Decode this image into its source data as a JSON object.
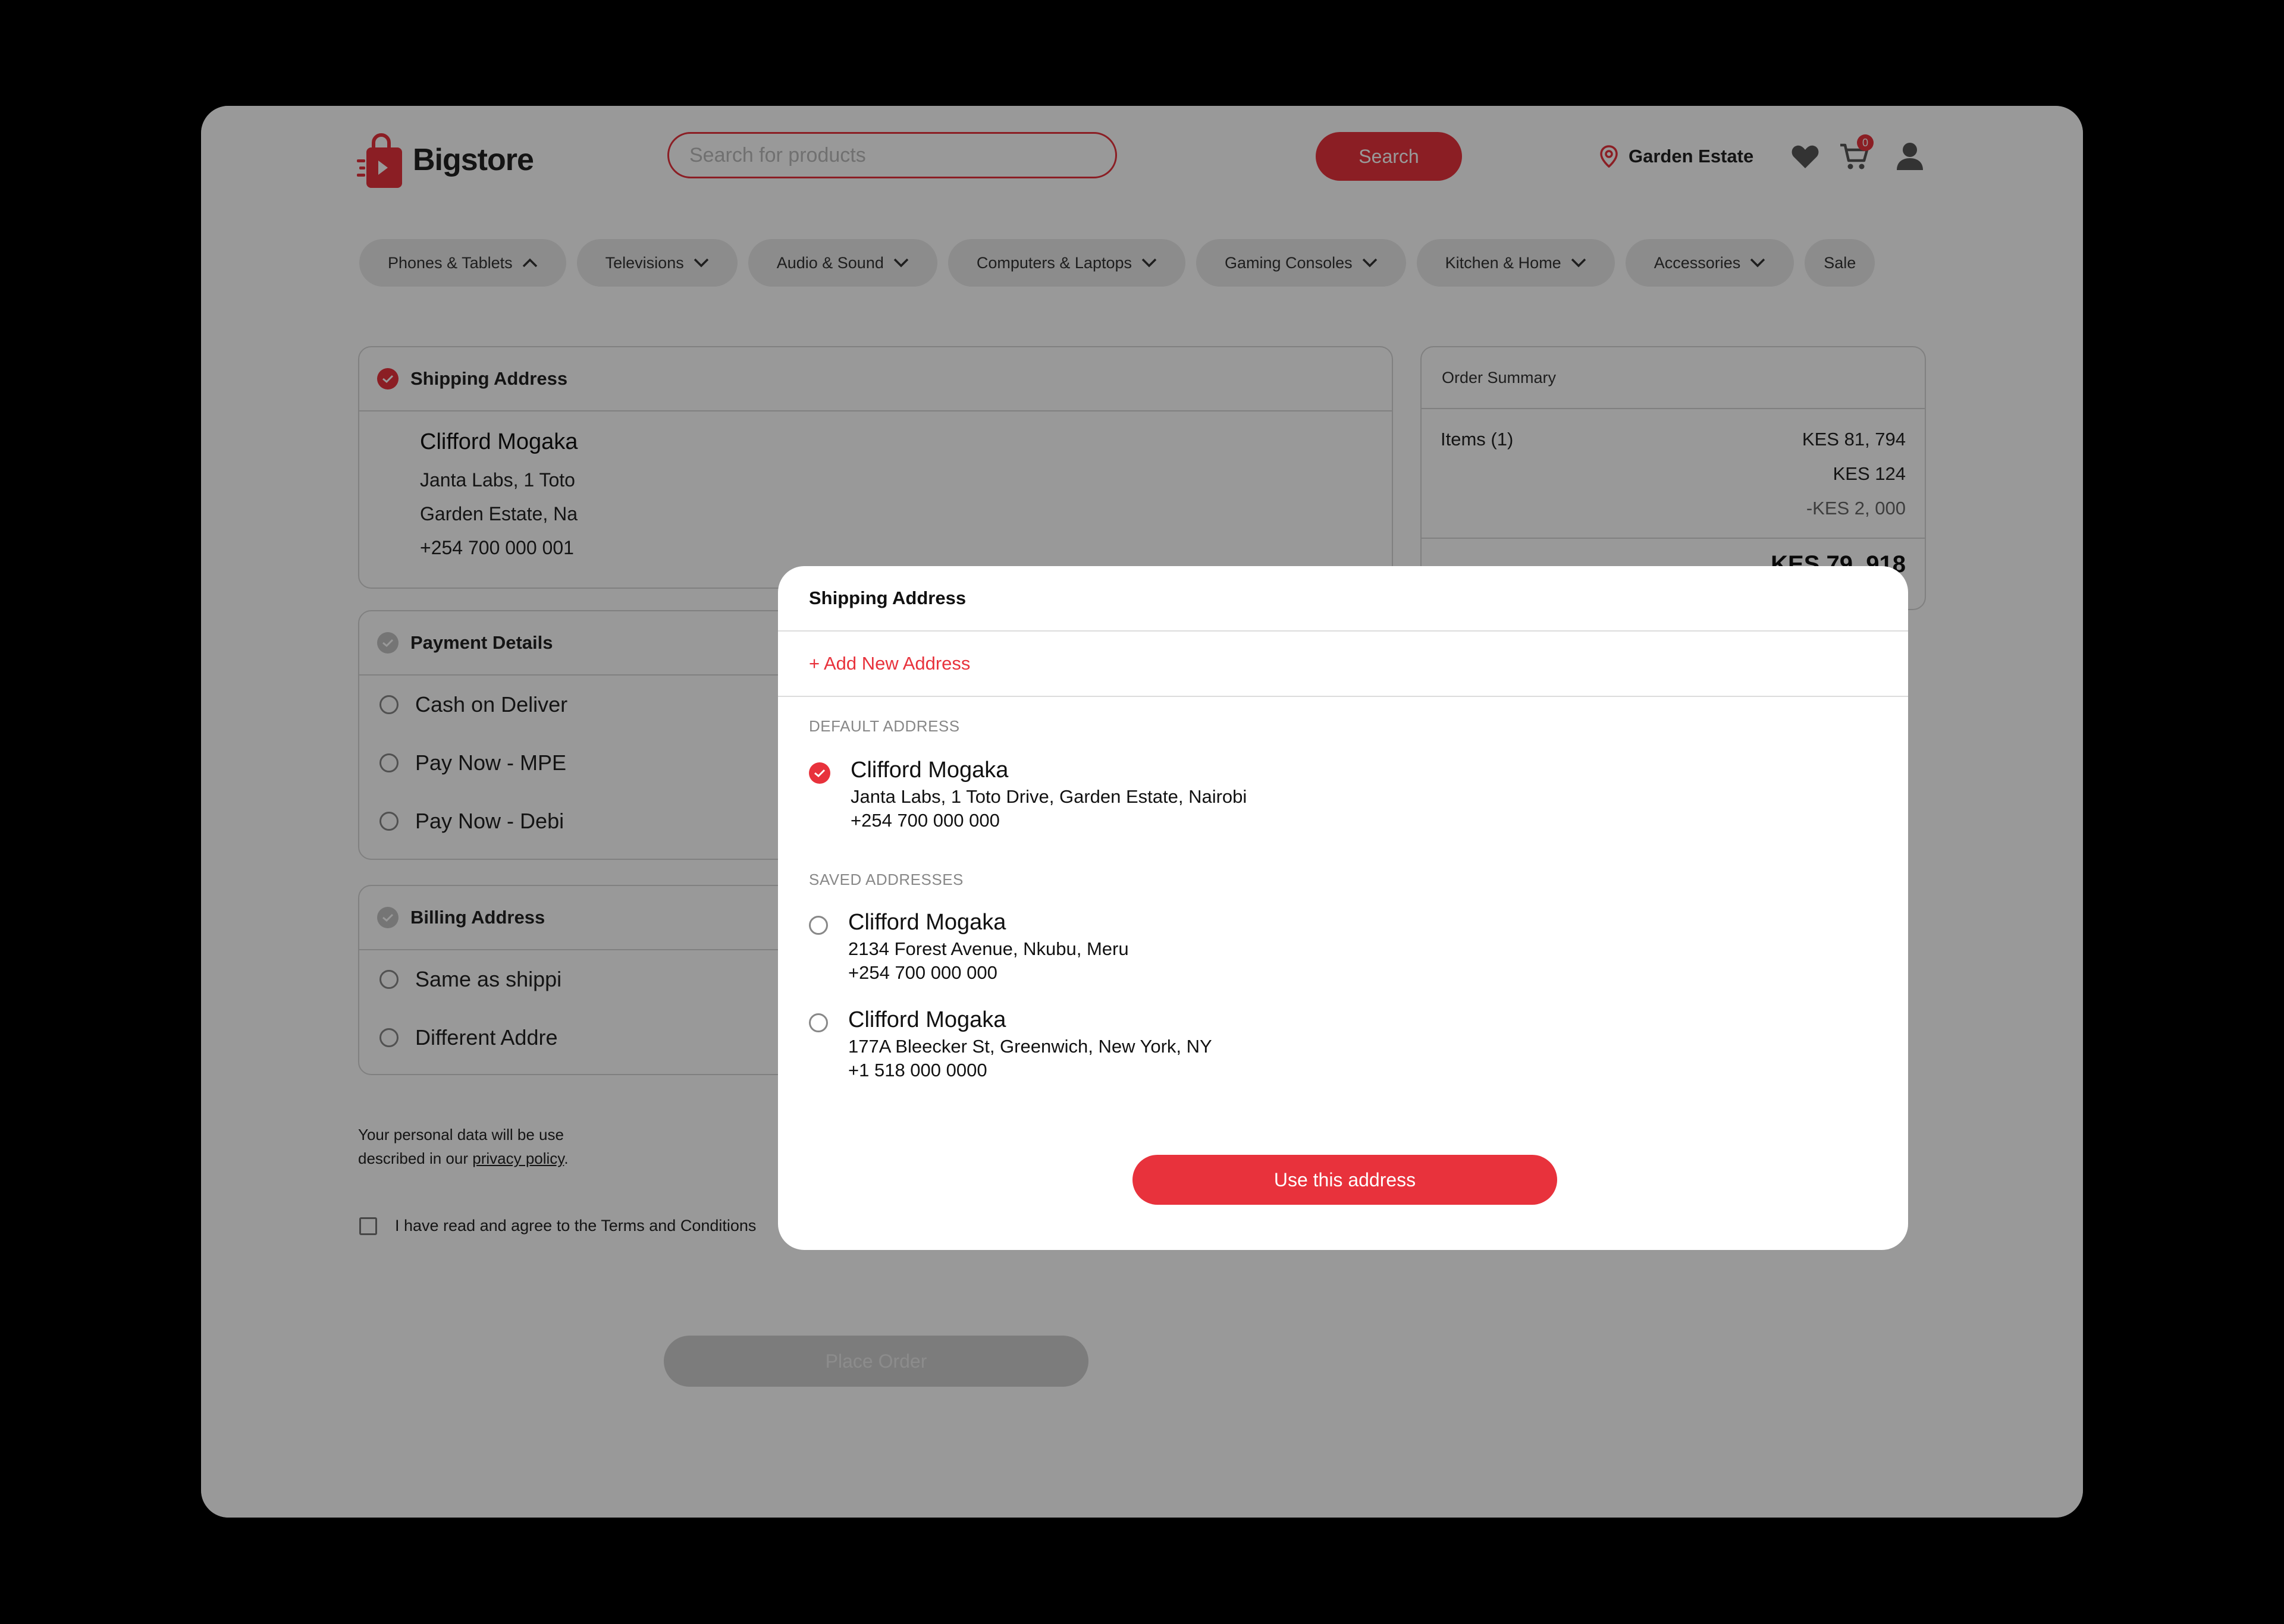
{
  "brand": {
    "name": "Bigstore",
    "accent": "#e8323c"
  },
  "header": {
    "search_placeholder": "Search for products",
    "search_button": "Search",
    "location": "Garden Estate",
    "cart_count": "0"
  },
  "categories": [
    {
      "label": "Phones & Tablets",
      "expanded": true
    },
    {
      "label": "Televisions",
      "expanded": false
    },
    {
      "label": "Audio & Sound",
      "expanded": false
    },
    {
      "label": "Computers & Laptops",
      "expanded": false
    },
    {
      "label": "Gaming Consoles",
      "expanded": false
    },
    {
      "label": "Kitchen & Home",
      "expanded": false
    },
    {
      "label": "Accessories",
      "expanded": false
    },
    {
      "label": "Sale"
    }
  ],
  "shipping": {
    "title": "Shipping Address",
    "name": "Clifford Mogaka",
    "line1": "Janta Labs, 1 Toto",
    "line2": "Garden Estate, Na",
    "phone": "+254 700 000 001"
  },
  "payment": {
    "title": "Payment Details",
    "options": [
      "Cash on Deliver",
      "Pay Now - MPE",
      "Pay Now - Debi"
    ]
  },
  "billing": {
    "title": "Billing Address",
    "options": [
      "Same as shippi",
      "Different Addre"
    ]
  },
  "summary": {
    "title": "Order Summary",
    "items_label": "Items (1)",
    "items_value": "KES 81, 794",
    "row2_value": "KES 124",
    "row3_value": "-KES 2, 000",
    "total_value": "KES 79, 918"
  },
  "legal": {
    "text_before": "Your personal data will be use",
    "text_after": "described in our",
    "link": "privacy policy",
    "end": "."
  },
  "terms_label": "I have read and agree to the Terms and Conditions",
  "place_order": "Place Order",
  "modal": {
    "title": "Shipping Address",
    "add_new": "+ Add New Address",
    "default_label": "DEFAULT ADDRESS",
    "default_address": {
      "name": "Clifford Mogaka",
      "line": "Janta Labs, 1 Toto Drive, Garden Estate, Nairobi",
      "phone": "+254 700 000 000"
    },
    "saved_label": "SAVED ADDRESSES",
    "saved_addresses": [
      {
        "name": "Clifford Mogaka",
        "line": "2134 Forest Avenue, Nkubu, Meru",
        "phone": "+254 700 000 000"
      },
      {
        "name": "Clifford Mogaka",
        "line": "177A Bleecker St, Greenwich, New York, NY",
        "phone": "+1 518 000 0000"
      }
    ],
    "use_button": "Use this address"
  }
}
